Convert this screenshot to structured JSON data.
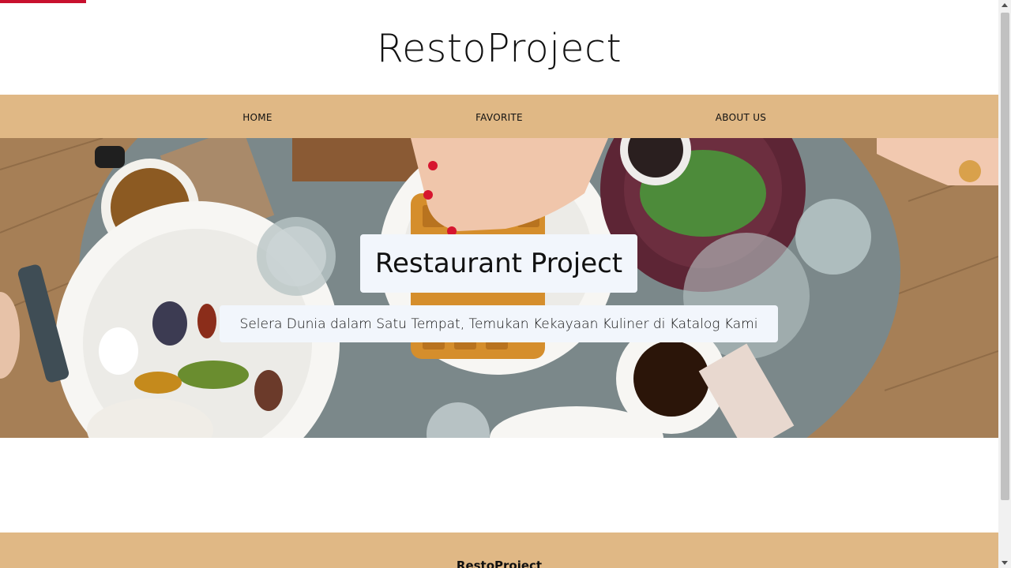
{
  "header": {
    "brand": "RestoProject"
  },
  "nav": {
    "items": [
      {
        "label": "HOME"
      },
      {
        "label": "FAVORITE"
      },
      {
        "label": "ABOUT US"
      }
    ]
  },
  "hero": {
    "title": "Restaurant Project",
    "subtitle": "Selera Dunia dalam Satu Tempat, Temukan Kekayaan Kuliner di Katalog Kami",
    "image": "hero-food-table-photo"
  },
  "footer": {
    "title": "RestoProject"
  },
  "colors": {
    "accent": "#e0b885",
    "loading_bar": "#c8102e",
    "hero_box": "#f2f6fc"
  }
}
